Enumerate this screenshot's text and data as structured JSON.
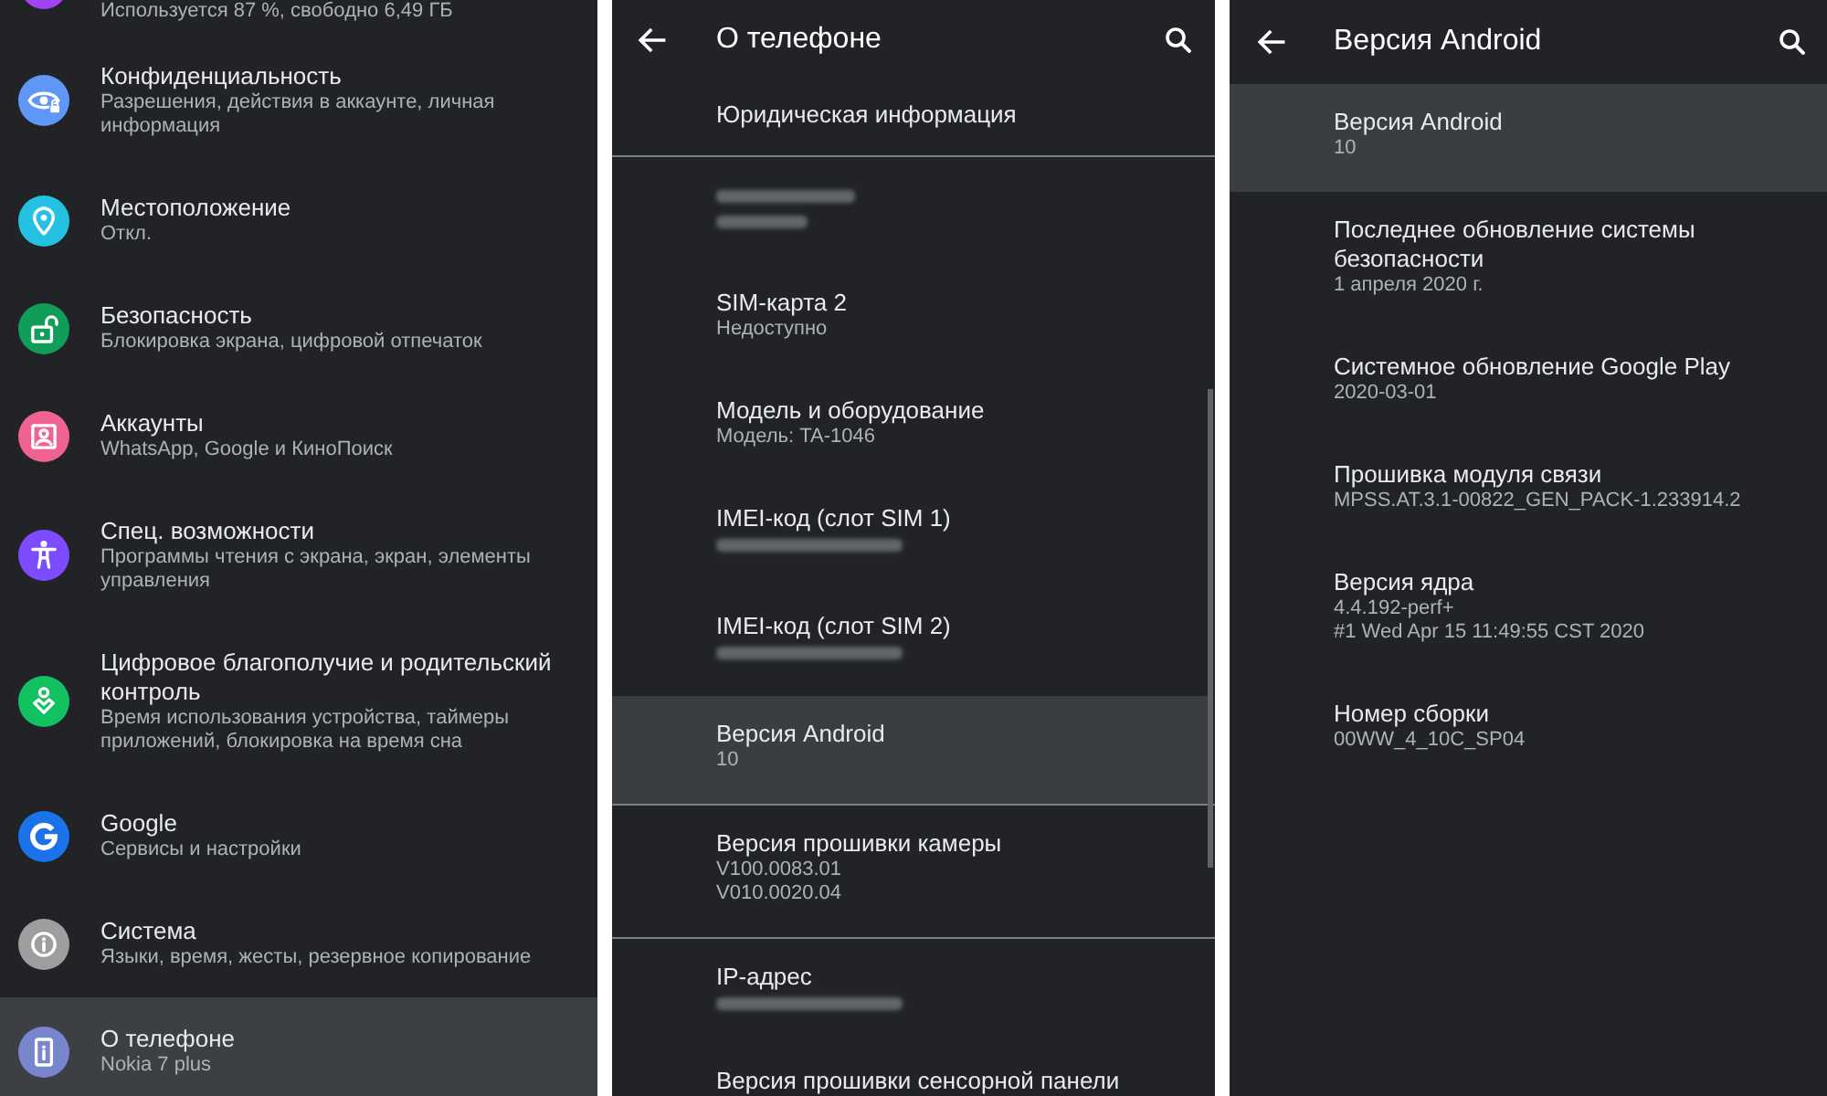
{
  "settings_list": {
    "items": [
      {
        "subtitle": "Используется 87 %, свободно 6,49 ГБ",
        "color": "#a142f4",
        "selected": false
      },
      {
        "title": "Конфиденциальность",
        "subtitle": "Разрешения, действия в аккаунте, личная информация",
        "color": "#5e97f6",
        "selected": false
      },
      {
        "title": "Местоположение",
        "subtitle": "Откл.",
        "color": "#24c1e0",
        "selected": false
      },
      {
        "title": "Безопасность",
        "subtitle": "Блокировка экрана, цифровой отпечаток",
        "color": "#0f9d58",
        "selected": false
      },
      {
        "title": "Аккаунты",
        "subtitle": "WhatsApp, Google и КиноПоиск",
        "color": "#f06292",
        "selected": false
      },
      {
        "title": "Спец. возможности",
        "subtitle": "Программы чтения с экрана, экран, элементы управления",
        "color": "#7c4dff",
        "selected": false
      },
      {
        "title": "Цифровое благополучие и родительский контроль",
        "subtitle": "Время использования устройства, таймеры приложений, блокировка на время сна",
        "color": "#12c160",
        "selected": false
      },
      {
        "title": "Google",
        "subtitle": "Сервисы и настройки",
        "color": "#1a73e8",
        "selected": false
      },
      {
        "title": "Система",
        "subtitle": "Языки, время, жесты, резервное копирование",
        "color": "#9e9e9e",
        "selected": false
      },
      {
        "title": "О телефоне",
        "subtitle": "Nokia 7 plus",
        "color": "#7986cb",
        "selected": true
      }
    ]
  },
  "about_phone": {
    "title": "О телефоне",
    "sections": [
      {
        "rows": [
          {
            "kind": "text",
            "title": "Юридическая информация",
            "selected": false
          }
        ]
      },
      {
        "rows": [
          {
            "kind": "blurred",
            "selected": false
          },
          {
            "kind": "text",
            "title": "SIM-карта 2",
            "summary": [
              "Недоступно"
            ],
            "selected": false
          },
          {
            "kind": "text",
            "title": "Модель и оборудование",
            "summary": [
              "Модель: TA-1046"
            ],
            "selected": false
          },
          {
            "kind": "blurred-value",
            "title": "IMEI-код (слот SIM 1)",
            "selected": false
          },
          {
            "kind": "blurred-value",
            "title": "IMEI-код (слот SIM 2)",
            "selected": false
          },
          {
            "kind": "text",
            "title": "Версия Android",
            "summary": [
              "10"
            ],
            "selected": true
          }
        ]
      },
      {
        "rows": [
          {
            "kind": "text",
            "title": "Версия прошивки камеры",
            "summary": [
              "V100.0083.01",
              "V010.0020.04"
            ],
            "selected": false
          }
        ]
      },
      {
        "rows": [
          {
            "kind": "blurred-value",
            "title": "IP-адрес",
            "selected": false
          },
          {
            "kind": "text",
            "title": "Версия прошивки сенсорной панели",
            "selected": false
          }
        ]
      }
    ]
  },
  "android_version": {
    "title": "Версия Android",
    "rows": [
      {
        "kind": "text",
        "title": "Версия Android",
        "summary": [
          "10"
        ],
        "selected": true
      },
      {
        "kind": "text",
        "title": "Последнее обновление системы безопасности",
        "summary": [
          "1 апреля 2020 г."
        ],
        "selected": false
      },
      {
        "kind": "text",
        "title": "Системное обновление Google Play",
        "summary": [
          "2020-03-01"
        ],
        "selected": false
      },
      {
        "kind": "text",
        "title": "Прошивка модуля связи",
        "summary": [
          "MPSS.AT.3.1-00822_GEN_PACK-1.233914.2"
        ],
        "selected": false
      },
      {
        "kind": "text",
        "title": "Версия ядра",
        "summary": [
          "4.4.192-perf+",
          "#1 Wed Apr 15 11:49:55 CST 2020"
        ],
        "selected": false
      },
      {
        "kind": "text",
        "title": "Номер сборки",
        "summary": [
          "00WW_4_10C_SP04"
        ],
        "selected": false
      }
    ]
  }
}
